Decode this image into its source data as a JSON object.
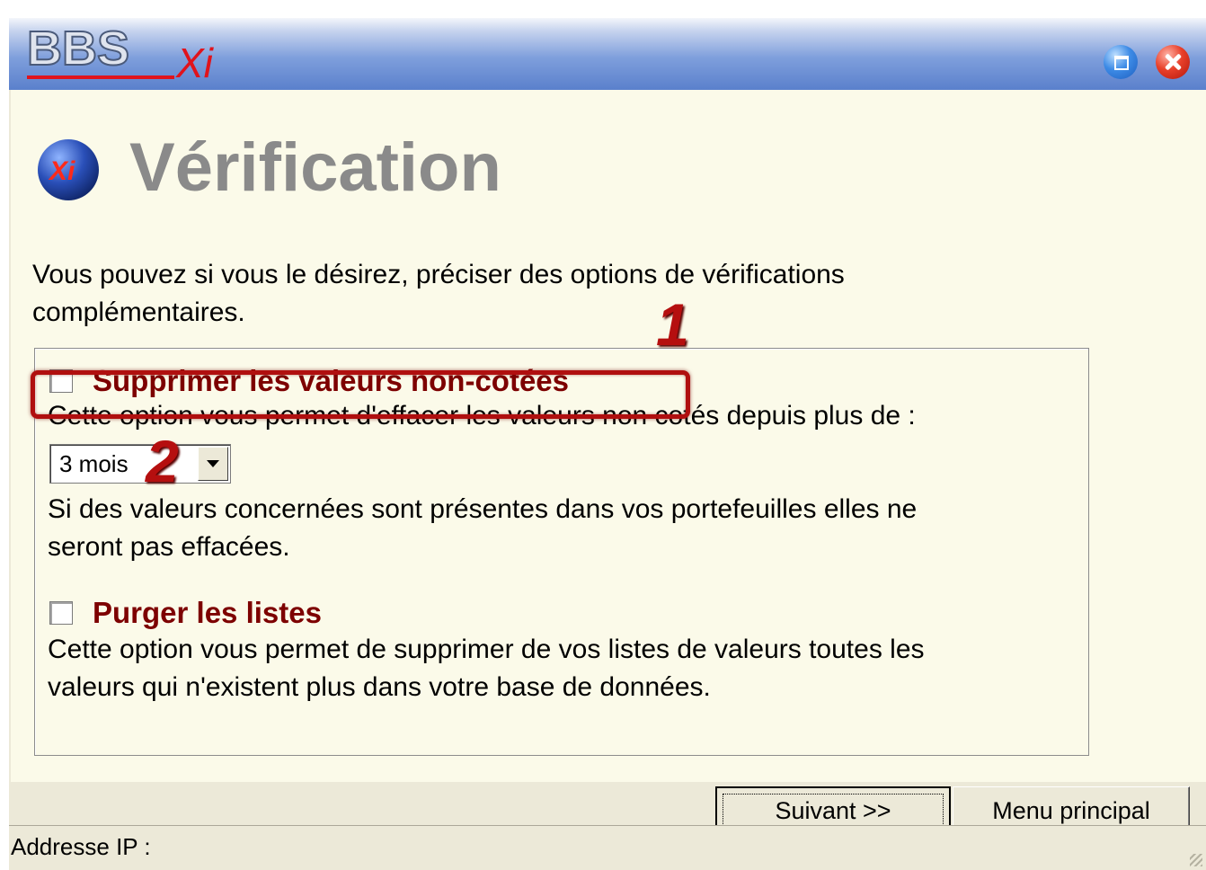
{
  "window": {
    "logo_text_main": "BBS",
    "logo_text_sub": "Xi"
  },
  "header": {
    "icon_label": "Xi",
    "title": "Vérification"
  },
  "intro_lines": [
    "Vous pouvez si vous le désirez, préciser des options de vérifications",
    "complémentaires."
  ],
  "options": {
    "delete_unlisted": {
      "label": "Supprimer les valeurs non-cotées",
      "checked": false,
      "description": "Cette option vous permet d'effacer les valeurs non cotés depuis plus de :",
      "period_selected": "3 mois",
      "note_lines": [
        "Si des valeurs concernées sont présentes dans vos portefeuilles elles ne",
        "seront pas effacées."
      ]
    },
    "purge_lists": {
      "label": "Purger les listes",
      "checked": false,
      "description_lines": [
        "Cette option vous permet de supprimer de vos listes de valeurs toutes les",
        "valeurs qui n'existent plus dans votre base de données."
      ]
    }
  },
  "annotations": {
    "marker_1": "1",
    "marker_2": "2"
  },
  "buttons": {
    "next_label": "Suivant >>",
    "menu_label": "Menu principal"
  },
  "status": {
    "ip_label": "Addresse IP :"
  },
  "colors": {
    "option_title": "#7d0000",
    "annotation": "#b50f0f",
    "title_gray": "#8a8a8a",
    "panel_bg": "#fbfae9"
  },
  "icons": [
    "maximize-icon",
    "close-icon",
    "xi-logo-icon",
    "dropdown-arrow-icon",
    "resize-grip-icon"
  ]
}
